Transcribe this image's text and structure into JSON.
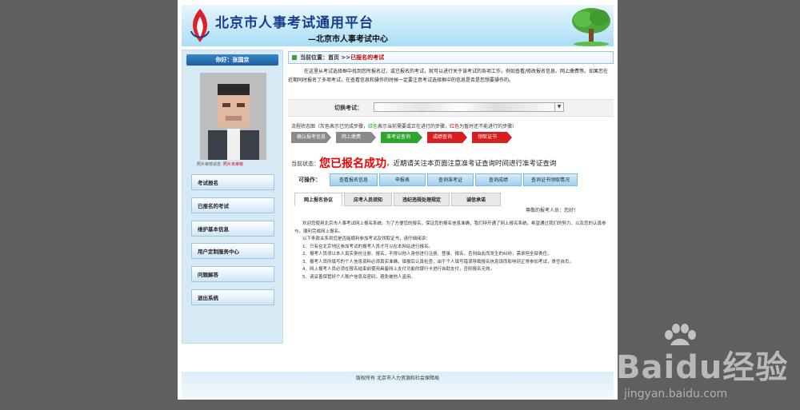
{
  "header": {
    "title": "北京市人事考试通用平台",
    "subtitle": "—北京市人事考试中心"
  },
  "sidebar": {
    "greeting": "你好：张国京",
    "photo_status_ok": "照片审核状态",
    "photo_status_fail": "照片未审核",
    "menu": [
      {
        "label": "考试报名"
      },
      {
        "label": "已报名的考试"
      },
      {
        "label": "维护基本信息"
      },
      {
        "label": "用户定制服务中心"
      },
      {
        "label": "问题解答"
      },
      {
        "label": "退出系统"
      }
    ]
  },
  "location": {
    "prefix": "当前位置：",
    "home": "首页",
    "sep": " >>",
    "current": "已报名的考试"
  },
  "intro": "在这里从考试选择框中找到您所报名过，或已报名的考试，就可以进行关于该考试的各项工作，例如查看/修改报名信息、网上缴费等。如果您在近期同时报名了多项考试，在查看信息和操作的时候一定要注意考试选择框中的信息是否是您想要操作的。",
  "switch": {
    "label": "切换考试："
  },
  "legend": {
    "prefix": "流程状态图（灰色表示已完成步骤，",
    "green": "绿色",
    "mid": "表示当前需要或正在进行的步骤，",
    "red": "红色",
    "suffix": "为暂时还不能进行的步骤）"
  },
  "steps": [
    {
      "label": "确认报考信息",
      "color": "#8a8a8a"
    },
    {
      "label": "网上缴费",
      "color": "#8a8a8a"
    },
    {
      "label": "准考证查询",
      "color": "#2ea52e"
    },
    {
      "label": "成绩查询",
      "color": "#d81e1e"
    },
    {
      "label": "领取证书",
      "color": "#d81e1e"
    }
  ],
  "status": {
    "label": "当前状态：",
    "highlight": "您已报名成功",
    "message": "，近期请关注本页面注意准考证查询时间进行准考证查询"
  },
  "operations": {
    "label": "可操作：",
    "buttons": [
      "查看报名信息",
      "申报表",
      "查询准考证",
      "查询成绩",
      "查询证书领取情况"
    ]
  },
  "tabs": [
    "网上报名协议",
    "应考人员须知",
    "违纪违规处理规定",
    "诚信承诺"
  ],
  "dear": "尊敬的报考人员：您好！",
  "notice": {
    "para1": "欢迎您使用北京市人事考试网上报名系统。为了方便您的报名，保证您的报名信息准确，我们特开通了网上报名系统。希望通过我们的努力，以及您的认真参与，顺利完成网上报名。",
    "para2": "以下条款关系到您是否能顺利参加考试及领取证书，请仔细阅读：",
    "items": [
      "1、只有在北京地区参加考试的报考人员才可以在本网站进行报名。",
      "2、报考人员须以本人真实身份注册、报名，不得以他人身份进行注册、登录、报名，否则由此而发生的纠纷，需承担全部责任。",
      "3、报考人员所填写的个人信息资料必须真实准确，填报后认真检查，由于个人填写错误导致报名信息误而影响到正常参加考试，责任自负。",
      "4、网上报考人员必须在报名结束前使用具备网上支付功能的银行卡进行自助支付，否则报名无效。",
      "5、请妥善保管好个人账户信息及密码，避免被他人盗用。"
    ]
  },
  "footer": "版权所有 北京市人力资源和社会保障局",
  "watermark": {
    "brand": "Baidu经验",
    "url": "jingyan.baidu.com"
  }
}
